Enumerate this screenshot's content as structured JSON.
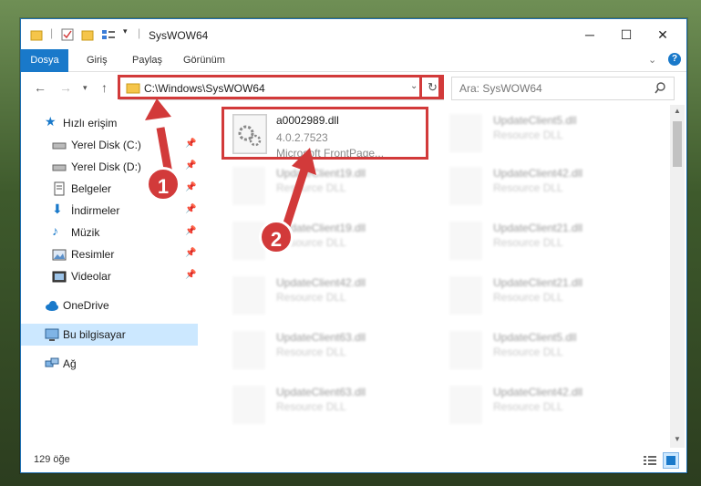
{
  "window": {
    "title": "SysWOW64"
  },
  "ribbon": {
    "tabs": [
      "Dosya",
      "Giriş",
      "Paylaş",
      "Görünüm"
    ]
  },
  "address_bar": {
    "path": "C:\\Windows\\SysWOW64"
  },
  "search": {
    "placeholder": "Ara: SysWOW64"
  },
  "sidebar": {
    "quick_access": "Hızlı erişim",
    "items": [
      {
        "label": "Yerel Disk (C:)",
        "icon": "drive-icon"
      },
      {
        "label": "Yerel Disk (D:)",
        "icon": "drive-icon"
      },
      {
        "label": "Belgeler",
        "icon": "documents-icon"
      },
      {
        "label": "İndirmeler",
        "icon": "downloads-icon"
      },
      {
        "label": "Müzik",
        "icon": "music-icon"
      },
      {
        "label": "Resimler",
        "icon": "pictures-icon"
      },
      {
        "label": "Videolar",
        "icon": "videos-icon"
      }
    ],
    "onedrive": "OneDrive",
    "this_pc": "Bu bilgisayar",
    "network": "Ağ"
  },
  "files": {
    "highlighted": {
      "name": "a0002989.dll",
      "version": "4.0.2.7523",
      "desc": "Microsoft FrontPage..."
    },
    "left": [
      {
        "name": "UpdateClient19.dll",
        "desc": "Resource DLL"
      },
      {
        "name": "UpdateClient19.dll",
        "desc": "Resource DLL"
      },
      {
        "name": "UpdateClient42.dll",
        "desc": "Resource DLL"
      },
      {
        "name": "UpdateClient63.dll",
        "desc": "Resource DLL"
      },
      {
        "name": "UpdateClient63.dll",
        "desc": "Resource DLL"
      }
    ],
    "right": [
      {
        "name": "UpdateClient5.dll",
        "desc": "Resource DLL"
      },
      {
        "name": "UpdateClient42.dll",
        "desc": "Resource DLL"
      },
      {
        "name": "UpdateClient21.dll",
        "desc": "Resource DLL"
      },
      {
        "name": "UpdateClient21.dll",
        "desc": "Resource DLL"
      },
      {
        "name": "UpdateClient5.dll",
        "desc": "Resource DLL"
      },
      {
        "name": "UpdateClient42.dll",
        "desc": "Resource DLL"
      }
    ]
  },
  "status": {
    "count": "129 öğe"
  },
  "annotations": {
    "step1": "1",
    "step2": "2"
  },
  "colors": {
    "accent": "#1979ca",
    "highlight": "#d23a3a",
    "selection": "#cce8ff"
  }
}
